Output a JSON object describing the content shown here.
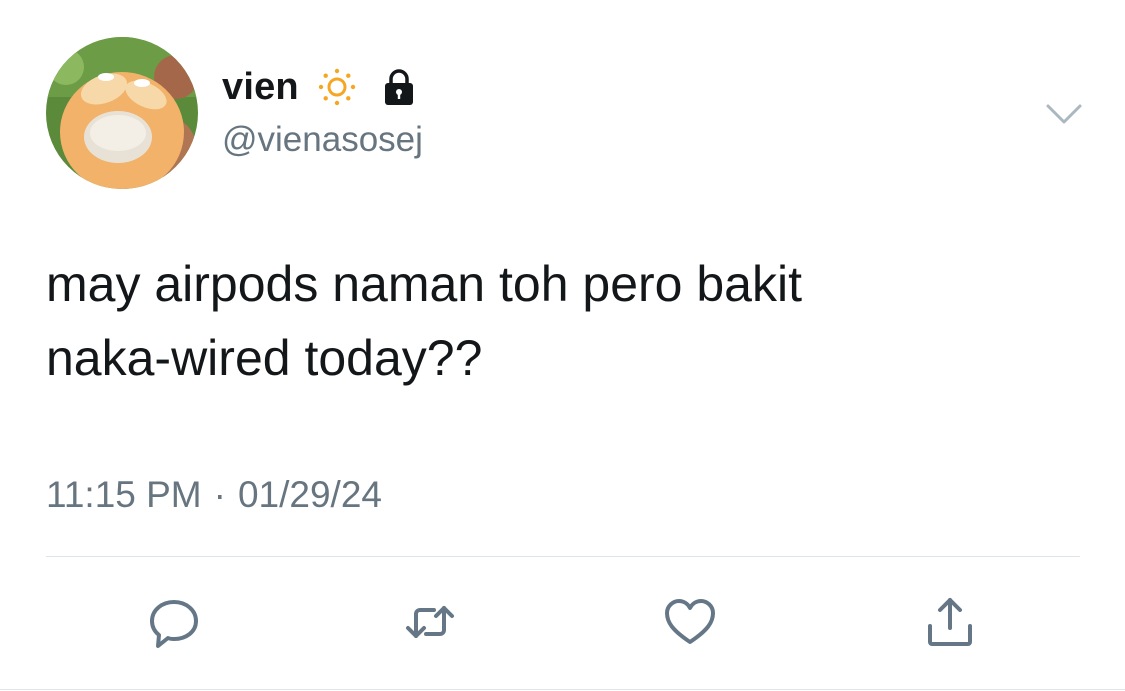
{
  "user": {
    "display_name": "vien",
    "handle": "@vienasosej",
    "badges": [
      "sun-icon",
      "lock-icon"
    ]
  },
  "tweet": {
    "text": "may airpods naman toh pero bakit\nnaka-wired today??",
    "time": "11:15 PM",
    "separator": "·",
    "date": "01/29/24"
  },
  "actions": [
    "reply-icon",
    "retweet-icon",
    "like-icon",
    "share-icon"
  ],
  "colors": {
    "text": "#14171a",
    "secondary": "#66757f",
    "icon": "#657786",
    "divider": "#dfe4e8"
  }
}
